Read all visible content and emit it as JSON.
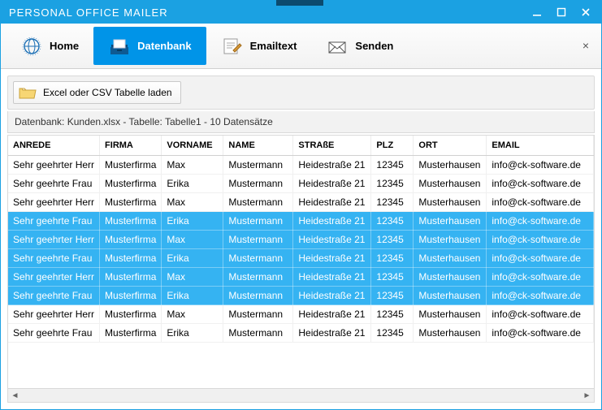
{
  "window": {
    "title": "PERSONAL OFFICE MAILER"
  },
  "ribbon": {
    "home": "Home",
    "database": "Datenbank",
    "emailtext": "Emailtext",
    "send": "Senden"
  },
  "toolbar": {
    "load_label": "Excel oder CSV Tabelle laden"
  },
  "status": {
    "text": "Datenbank: Kunden.xlsx  -  Tabelle: Tabelle1  -  10 Datensätze"
  },
  "table": {
    "headers": {
      "anrede": "ANREDE",
      "firma": "FIRMA",
      "vorname": "VORNAME",
      "name": "NAME",
      "strasse": "STRAßE",
      "plz": "PLZ",
      "ort": "ORT",
      "email": "EMAIL"
    },
    "rows": [
      {
        "anrede": "Sehr geehrter Herr",
        "firma": "Musterfirma",
        "vorname": "Max",
        "name": "Mustermann",
        "strasse": "Heidestraße 21",
        "plz": "12345",
        "ort": "Musterhausen",
        "email": "info@ck-software.de",
        "selected": false
      },
      {
        "anrede": "Sehr geehrte Frau",
        "firma": "Musterfirma",
        "vorname": "Erika",
        "name": "Mustermann",
        "strasse": "Heidestraße 21",
        "plz": "12345",
        "ort": "Musterhausen",
        "email": "info@ck-software.de",
        "selected": false
      },
      {
        "anrede": "Sehr geehrter Herr",
        "firma": "Musterfirma",
        "vorname": "Max",
        "name": "Mustermann",
        "strasse": "Heidestraße 21",
        "plz": "12345",
        "ort": "Musterhausen",
        "email": "info@ck-software.de",
        "selected": false
      },
      {
        "anrede": "Sehr geehrte Frau",
        "firma": "Musterfirma",
        "vorname": "Erika",
        "name": "Mustermann",
        "strasse": "Heidestraße 21",
        "plz": "12345",
        "ort": "Musterhausen",
        "email": "info@ck-software.de",
        "selected": true
      },
      {
        "anrede": "Sehr geehrter Herr",
        "firma": "Musterfirma",
        "vorname": "Max",
        "name": "Mustermann",
        "strasse": "Heidestraße 21",
        "plz": "12345",
        "ort": "Musterhausen",
        "email": "info@ck-software.de",
        "selected": true
      },
      {
        "anrede": "Sehr geehrte Frau",
        "firma": "Musterfirma",
        "vorname": "Erika",
        "name": "Mustermann",
        "strasse": "Heidestraße 21",
        "plz": "12345",
        "ort": "Musterhausen",
        "email": "info@ck-software.de",
        "selected": true
      },
      {
        "anrede": "Sehr geehrter Herr",
        "firma": "Musterfirma",
        "vorname": "Max",
        "name": "Mustermann",
        "strasse": "Heidestraße 21",
        "plz": "12345",
        "ort": "Musterhausen",
        "email": "info@ck-software.de",
        "selected": true
      },
      {
        "anrede": "Sehr geehrte Frau",
        "firma": "Musterfirma",
        "vorname": "Erika",
        "name": "Mustermann",
        "strasse": "Heidestraße 21",
        "plz": "12345",
        "ort": "Musterhausen",
        "email": "info@ck-software.de",
        "selected": true
      },
      {
        "anrede": "Sehr geehrter Herr",
        "firma": "Musterfirma",
        "vorname": "Max",
        "name": "Mustermann",
        "strasse": "Heidestraße 21",
        "plz": "12345",
        "ort": "Musterhausen",
        "email": "info@ck-software.de",
        "selected": false
      },
      {
        "anrede": "Sehr geehrte Frau",
        "firma": "Musterfirma",
        "vorname": "Erika",
        "name": "Mustermann",
        "strasse": "Heidestraße 21",
        "plz": "12345",
        "ort": "Musterhausen",
        "email": "info@ck-software.de",
        "selected": false
      }
    ]
  }
}
